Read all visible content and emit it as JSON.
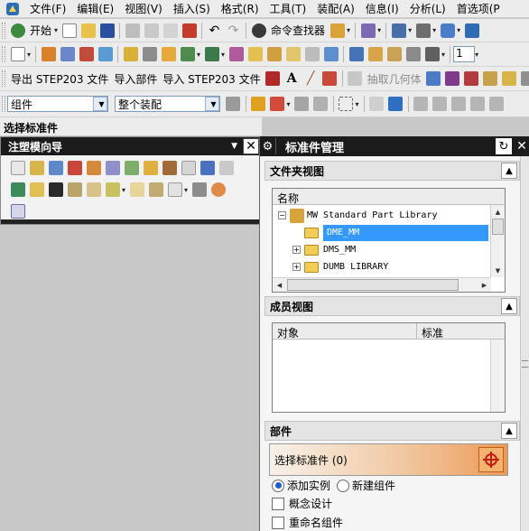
{
  "menubar": {
    "items": [
      "文件(F)",
      "编辑(E)",
      "视图(V)",
      "插入(S)",
      "格式(R)",
      "工具(T)",
      "装配(A)",
      "信息(I)",
      "分析(L)",
      "首选项(P"
    ]
  },
  "toolbar1": {
    "start_label": "开始",
    "cmd_finder_label": "命令查找器"
  },
  "toolbar2": {
    "spin_value": "1"
  },
  "toolbar3": {
    "items": [
      "导出 STEP203 文件",
      "导入部件",
      "导入 STEP203 文件"
    ],
    "extract_label": "抽取几何体"
  },
  "selection_bar": {
    "filter_value": "组件",
    "scope_value": "整个装配"
  },
  "status": {
    "prompt": "选择标准件"
  },
  "nav_panel": {
    "title": "注塑模向导"
  },
  "manager": {
    "title": "标准件管理",
    "folder_view": {
      "title": "文件夹视图",
      "column": "名称",
      "rows": [
        "MW Standard Part Library",
        "DME_MM",
        "DMS_MM",
        "DUMB LIBRARY"
      ]
    },
    "member_view": {
      "title": "成员视图",
      "columns": [
        "对象",
        "标准"
      ]
    },
    "part": {
      "title": "部件",
      "select_label": "选择标准件 (0)",
      "radio_add": "添加实例",
      "radio_new": "新建组件",
      "chk_concept": "概念设计",
      "chk_rename": "重命名组件"
    }
  },
  "colors": {
    "header_bg": "#1b1b1b",
    "selection": "#3399ff",
    "select_bar_end": "#ec9a58",
    "pick_button": "#f6b370"
  }
}
